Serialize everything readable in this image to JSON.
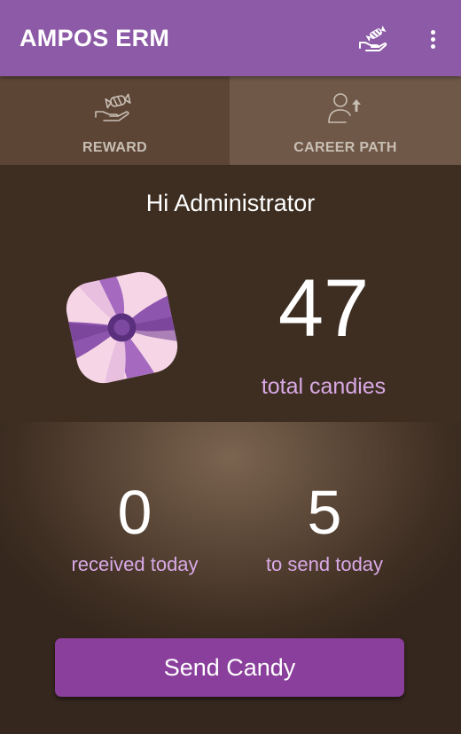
{
  "appbar": {
    "title": "AMPOS ERM",
    "candy_icon": "candy-hand-icon",
    "menu_icon": "more-vert-icon",
    "color": "#8c5aa6"
  },
  "tabs": [
    {
      "label": "REWARD",
      "icon": "candy-hand-icon"
    },
    {
      "label": "CAREER PATH",
      "icon": "person-arrow-up-icon"
    }
  ],
  "greeting": "Hi Administrator",
  "candies": {
    "total": "47",
    "total_label": "total candies",
    "icon": "candy-icon"
  },
  "stats": {
    "received": {
      "value": "0",
      "label": "received today"
    },
    "to_send": {
      "value": "5",
      "label": "to send today"
    }
  },
  "send_button": {
    "label": "Send Candy",
    "color": "#8a3f9c"
  },
  "colors": {
    "accent_purple": "#8c5aa6",
    "label_lilac": "#d9a9e6",
    "background_brown": "#3e2e22"
  }
}
